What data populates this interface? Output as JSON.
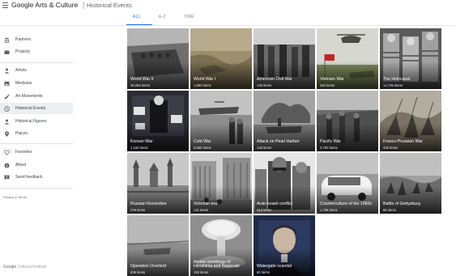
{
  "header": {
    "brand": "Google Arts & Culture",
    "page_title": "Historical Events"
  },
  "tabs": [
    {
      "label": "ALL",
      "active": true
    },
    {
      "label": "A-Z",
      "active": false
    },
    {
      "label": "TIME",
      "active": false
    }
  ],
  "sidebar": {
    "items": [
      {
        "label": "Partners",
        "icon": "building-icon"
      },
      {
        "label": "Projects",
        "icon": "folder-icon"
      },
      {
        "label": "Artists",
        "icon": "person-icon"
      },
      {
        "label": "Mediums",
        "icon": "image-icon"
      },
      {
        "label": "Art Movements",
        "icon": "brush-icon"
      },
      {
        "label": "Historical Events",
        "icon": "clock-icon",
        "active": true
      },
      {
        "label": "Historical Figures",
        "icon": "person-icon"
      },
      {
        "label": "Places",
        "icon": "location-pin-icon"
      },
      {
        "label": "Favorites",
        "icon": "heart-icon"
      },
      {
        "label": "About",
        "icon": "info-icon"
      },
      {
        "label": "Send feedback",
        "icon": "feedback-icon"
      }
    ],
    "privacy": "Privacy & Terms",
    "footer_brand": "Google",
    "footer_sub": "Cultural Institute"
  },
  "tiles": [
    {
      "title": "World War II",
      "count": "36,065 items"
    },
    {
      "title": "World War I",
      "count": "1,863 items"
    },
    {
      "title": "American Civil War",
      "count": "136 items"
    },
    {
      "title": "Vietnam War",
      "count": "484 items"
    },
    {
      "title": "The Holocaust",
      "count": "14,735 items"
    },
    {
      "title": "Korean War",
      "count": "1,193 items"
    },
    {
      "title": "Cold War",
      "count": "5,655 items"
    },
    {
      "title": "Attack on Pearl Harbor",
      "count": "129 items"
    },
    {
      "title": "Pacific War",
      "count": "2,750 items"
    },
    {
      "title": "Franco-Prussian War",
      "count": "436 items"
    },
    {
      "title": "Russian Revolution",
      "count": "276 items"
    },
    {
      "title": "Victorian era",
      "count": "131 items"
    },
    {
      "title": "Arab-Israeli conflict",
      "count": "313 items"
    },
    {
      "title": "Counterculture of the 1960s",
      "count": "1,798 items"
    },
    {
      "title": "Battle of Gettysburg",
      "count": "85 items"
    },
    {
      "title": "Operation Overlord",
      "count": "636 items"
    },
    {
      "title": "Atomic bombings of Hiroshima and Nagasaki",
      "count": "192 items"
    },
    {
      "title": "Watergate scandal",
      "count": "60 items"
    }
  ]
}
